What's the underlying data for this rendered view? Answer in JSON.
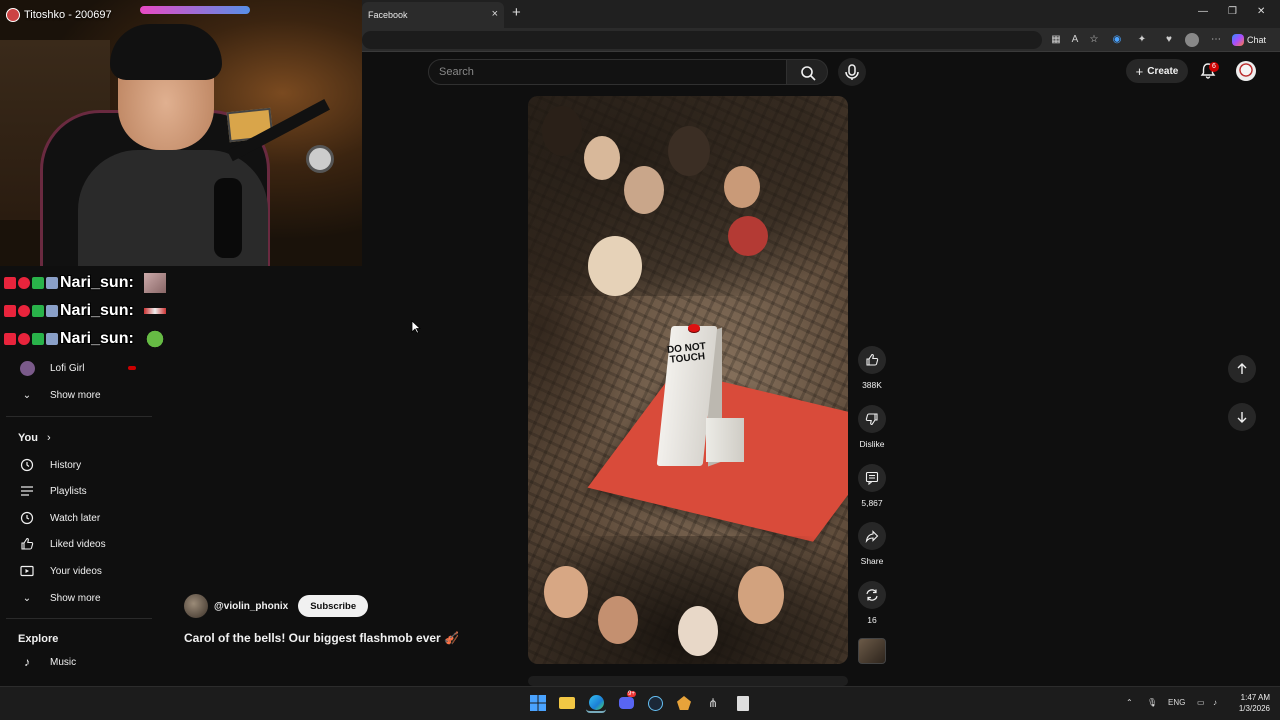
{
  "browser": {
    "tab_title": "Facebook",
    "tab_close": "×",
    "new_tab": "+",
    "chat_label": "Chat",
    "window_min": "—",
    "window_max": "❐",
    "window_close": "✕"
  },
  "youtube": {
    "search_placeholder": "Search",
    "create_label": "Create",
    "notification_count": "6"
  },
  "stream_overlay": {
    "streamer_name": "Titoshko - 200697",
    "chat": [
      {
        "user": "Nari_sun:"
      },
      {
        "user": "Nari_sun:"
      },
      {
        "user": "Nari_sun:"
      }
    ]
  },
  "sidebar": {
    "subscriptions": [
      {
        "label": "Lofi Girl",
        "live": true
      }
    ],
    "show_more_1": "Show more",
    "you_section": "You",
    "you_items": [
      {
        "label": "History",
        "icon": "history-icon"
      },
      {
        "label": "Playlists",
        "icon": "playlists-icon"
      },
      {
        "label": "Watch later",
        "icon": "clock-icon"
      },
      {
        "label": "Liked videos",
        "icon": "thumbs-up-icon"
      },
      {
        "label": "Your videos",
        "icon": "video-icon"
      }
    ],
    "show_more_2": "Show more",
    "explore_section": "Explore",
    "explore_items": [
      {
        "label": "Music",
        "icon": "music-icon"
      }
    ]
  },
  "video": {
    "sign_text": "DO NOT TOUCH",
    "channel": "@violin_phonix",
    "subscribe": "Subscribe",
    "title": "Carol of the bells! Our biggest flashmob ever 🎻",
    "likes": "388K",
    "dislike_label": "Dislike",
    "comments": "5,867",
    "share_label": "Share",
    "remix_count": "16"
  },
  "taskbar": {
    "language": "ENG",
    "time": "1:47 AM",
    "date": "1/3/2026",
    "discord_badge": "9+"
  },
  "colors": {
    "background": "#0f0f0f",
    "accent_red": "#cc0000",
    "carpet": "#d94b3a"
  }
}
